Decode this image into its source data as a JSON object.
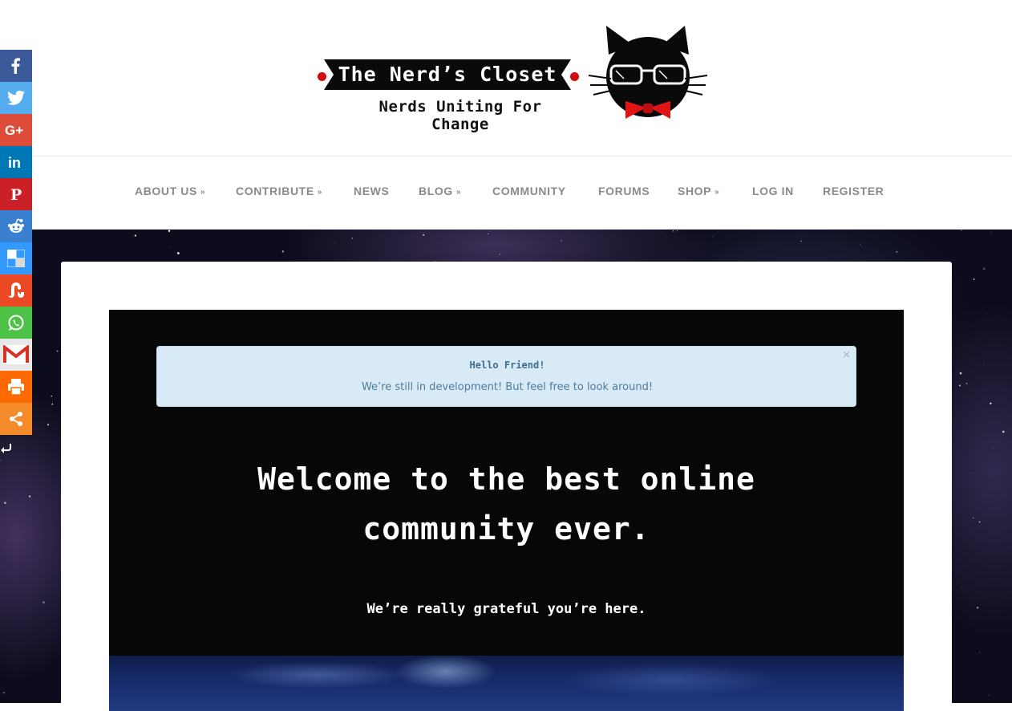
{
  "brand": {
    "title": "The Nerd’s Closet",
    "tagline": "Nerds Uniting For Change",
    "mascot_icon": "cat-with-sunglasses-and-bowtie",
    "accent_red": "#d10c0c"
  },
  "nav": {
    "items": [
      {
        "label": "ABOUT US",
        "dropdown": true
      },
      {
        "label": "CONTRIBUTE",
        "dropdown": true
      },
      {
        "label": "NEWS",
        "dropdown": false
      },
      {
        "label": "BLOG",
        "dropdown": true
      },
      {
        "label": "COMMUNITY",
        "dropdown": false
      },
      {
        "label": "FORUMS",
        "dropdown": false
      },
      {
        "label": "SHOP",
        "dropdown": true
      },
      {
        "label": "LOG IN",
        "dropdown": false
      },
      {
        "label": "REGISTER",
        "dropdown": false
      }
    ],
    "chevron": "»",
    "text_color": "#8a8a8a"
  },
  "alert": {
    "title": "Hello Friend!",
    "message": "We’re still in development! But feel free to look around!",
    "close_label": "×",
    "background": "#d8eaf5"
  },
  "hero": {
    "heading": "Welcome to the best online community ever.",
    "subheading": "We’re really grateful you’re here.",
    "background": "#070707"
  },
  "share": {
    "buttons": [
      {
        "name": "facebook",
        "icon": "facebook-icon",
        "color": "#3b5998"
      },
      {
        "name": "twitter",
        "icon": "twitter-icon",
        "color": "#55acee"
      },
      {
        "name": "google-plus",
        "icon": "google-plus-icon",
        "color": "#dd4b39"
      },
      {
        "name": "linkedin",
        "icon": "linkedin-icon",
        "color": "#0077b5"
      },
      {
        "name": "pinterest",
        "icon": "pinterest-icon",
        "color": "#cb2027"
      },
      {
        "name": "reddit",
        "icon": "reddit-icon",
        "color": "#3a80d0"
      },
      {
        "name": "delicious",
        "icon": "delicious-icon",
        "color": "#3399ff"
      },
      {
        "name": "stumbleupon",
        "icon": "stumbleupon-icon",
        "color": "#eb4924"
      },
      {
        "name": "whatsapp",
        "icon": "whatsapp-icon",
        "color": "#4dc247"
      },
      {
        "name": "gmail",
        "icon": "gmail-icon",
        "color": "#e8e8e8"
      },
      {
        "name": "print",
        "icon": "print-icon",
        "color": "#ff6a00"
      },
      {
        "name": "share",
        "icon": "share-icon",
        "color": "#f58a2b"
      }
    ],
    "hide_icon": "hide-arrow-icon"
  }
}
